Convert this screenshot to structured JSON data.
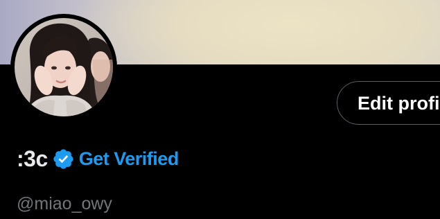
{
  "profile": {
    "display_name": ":3c",
    "get_verified_label": "Get Verified",
    "handle": "@miao_owy",
    "edit_profile_label": "Edit profile"
  },
  "icons": {
    "verified": "verified-badge-icon"
  },
  "colors": {
    "background": "#000000",
    "accent": "#1d9bf0",
    "name_text": "#e7e9ea",
    "secondary_text": "#71767b",
    "button_border": "#5a6068"
  }
}
